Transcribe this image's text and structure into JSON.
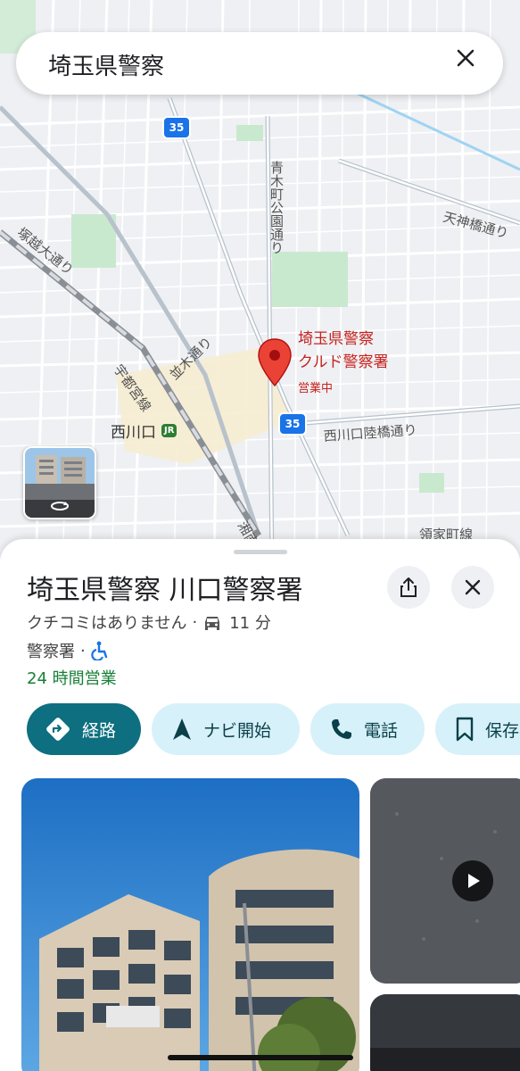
{
  "search": {
    "query": "埼玉県警察"
  },
  "map": {
    "route_badges": [
      "35",
      "35"
    ],
    "street_labels": {
      "tsukagoe": "塚越大通り",
      "aokicho": "青木町公園通り",
      "tenjinbashi": "天神橋通り",
      "utsunomiya": "宇都宮線",
      "namiki": "並木通り",
      "nishikawaguchi_rikkyo": "西川口陸橋通り",
      "shonan": "湘南",
      "ryoke": "領家町線"
    },
    "station": {
      "name": "西川口",
      "badge": "JR"
    },
    "pin": {
      "line1": "埼玉県警察",
      "line2": "クルド警察署",
      "status": "営業中"
    }
  },
  "sheet": {
    "title": "埼玉県警察 川口警察署",
    "reviews": "クチコミはありません",
    "drive_time": "11 分",
    "category": "警察署",
    "hours": "24 時間営業",
    "actions": [
      {
        "label": "経路",
        "icon": "directions-icon"
      },
      {
        "label": "ナビ開始",
        "icon": "navigation-arrow-icon"
      },
      {
        "label": "電話",
        "icon": "phone-icon"
      },
      {
        "label": "保存",
        "icon": "bookmark-icon"
      }
    ]
  },
  "colors": {
    "primary_chip": "#0d6f7f",
    "secondary_chip": "#d6f1f9",
    "open_green": "#188038",
    "pin_red": "#c5221f"
  }
}
